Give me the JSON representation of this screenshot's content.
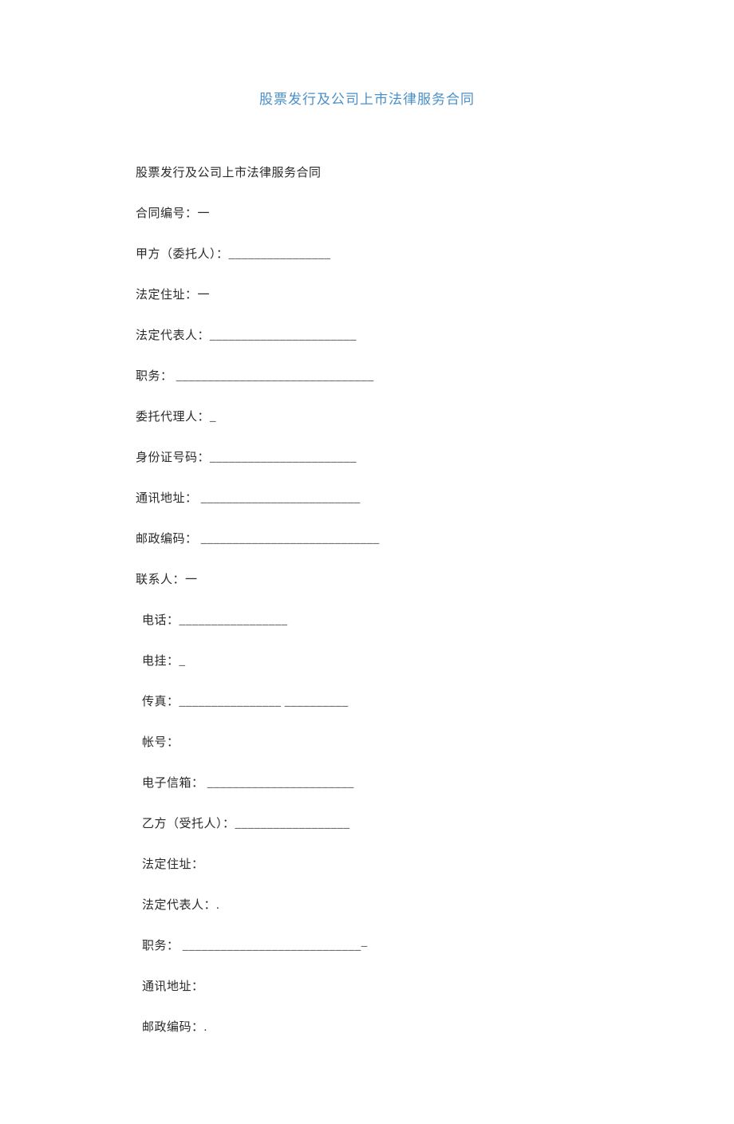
{
  "title": "股票发行及公司上市法律服务合同",
  "subtitle": "股票发行及公司上市法律服务合同",
  "partyA": {
    "contractNo": {
      "label": "合同编号：",
      "value": "一"
    },
    "principal": {
      "label": "甲方（委托人）：",
      "value": "________________"
    },
    "address": {
      "label": "法定住址：",
      "value": "一"
    },
    "legalRep": {
      "label": "法定代表人：",
      "value": "_______________________"
    },
    "position": {
      "label": "职务：",
      "value": "  _______________________________"
    },
    "agent": {
      "label": "委托代理人：",
      "value": "_"
    },
    "idNo": {
      "label": "身份证号码：",
      "value": "_______________________"
    },
    "mailAddr": {
      "label": "通讯地址：",
      "value": " _________________________"
    },
    "postCode": {
      "label": "邮政编码：",
      "value": " ____________________________"
    },
    "contact": {
      "label": "联系人：",
      "value": "一"
    }
  },
  "partyA_contact": {
    "phone": {
      "label": "电话：",
      "value": "_________________"
    },
    "telegraph": {
      "label": "电挂：",
      "value": "_"
    },
    "fax": {
      "label": "传真：",
      "value": "________________  __________"
    },
    "account": {
      "label": "帐号：",
      "value": ""
    },
    "email": {
      "label": "电子信箱：",
      "value": " _______________________"
    }
  },
  "partyB": {
    "trustee": {
      "label": "乙方（受托人）：",
      "value": "__________________"
    },
    "address": {
      "label": "法定住址：",
      "value": ""
    },
    "legalRep": {
      "label": "法定代表人：",
      "value": "."
    },
    "position": {
      "label": "职务：",
      "value": " ____________________________–"
    },
    "mailAddr": {
      "label": "通讯地址：",
      "value": ""
    },
    "postCode": {
      "label": "邮政编码：",
      "value": "."
    }
  }
}
